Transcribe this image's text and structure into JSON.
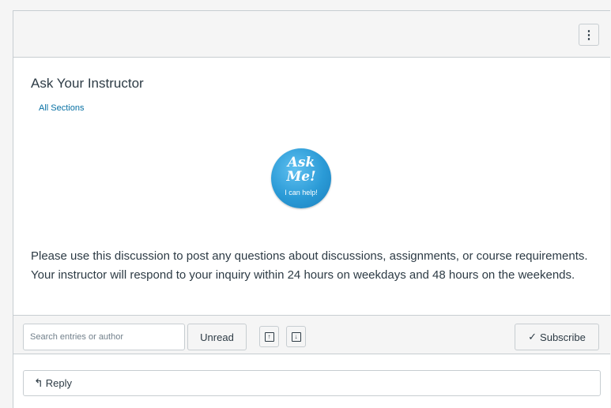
{
  "header": {
    "menu_icon": "kebab-menu-icon",
    "menu_glyph": "⋮"
  },
  "discussion": {
    "title": "Ask Your Instructor",
    "sections_link": "All Sections",
    "badge": {
      "line1": "Ask",
      "line2": "Me!",
      "line3": "I can help!"
    },
    "body": "Please use this discussion to post any questions about discussions, assignments, or course requirements. Your instructor will respond to your inquiry within 24 hours on weekdays and 48 hours on the weekends."
  },
  "toolbar": {
    "search_placeholder": "Search entries or author",
    "unread_label": "Unread",
    "expand_icon": "arrow-up-box-icon",
    "collapse_icon": "arrow-down-box-icon",
    "subscribe_icon": "checkmark-icon",
    "subscribe_label": "Subscribe"
  },
  "reply": {
    "icon": "reply-arrow-icon",
    "label": "Reply"
  },
  "colors": {
    "link": "#0770a3",
    "text": "#2d3b45",
    "border": "#c7cdd1",
    "badge": "#2a9ad6"
  }
}
